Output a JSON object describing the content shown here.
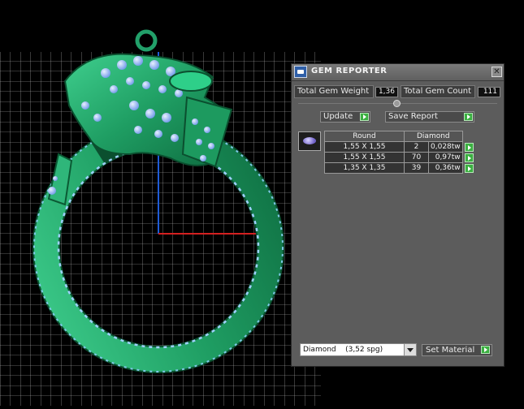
{
  "panel": {
    "title": "GEM REPORTER",
    "close_glyph": "✕",
    "total_gem_weight_label": "Total Gem Weight",
    "total_gem_weight_value": "1,36",
    "total_gem_count_label": "Total Gem Count",
    "total_gem_count_value": "111",
    "update_label": "Update",
    "save_report_label": "Save Report",
    "table": {
      "headers": [
        "Round",
        "Diamond"
      ],
      "rows": [
        {
          "size": "1,55 X 1,55",
          "qty": "2",
          "weight": "0,028tw"
        },
        {
          "size": "1,55 X 1,55",
          "qty": "70",
          "weight": "0,97tw"
        },
        {
          "size": "1,35 X 1,35",
          "qty": "39",
          "weight": "0,36tw"
        }
      ]
    },
    "material_value": "Diamond    (3,52 spg)",
    "set_material_label": "Set Material"
  },
  "icons": {
    "app": "gem-reporter-icon",
    "close": "close-icon",
    "go": "green-arrow-icon",
    "gem": "gem-thumbnail-icon"
  },
  "colors": {
    "model_green": "#22a06a",
    "gem_blue": "#8fb8ff",
    "grid": "#c8c8c8",
    "accent_green": "#3bb041"
  }
}
